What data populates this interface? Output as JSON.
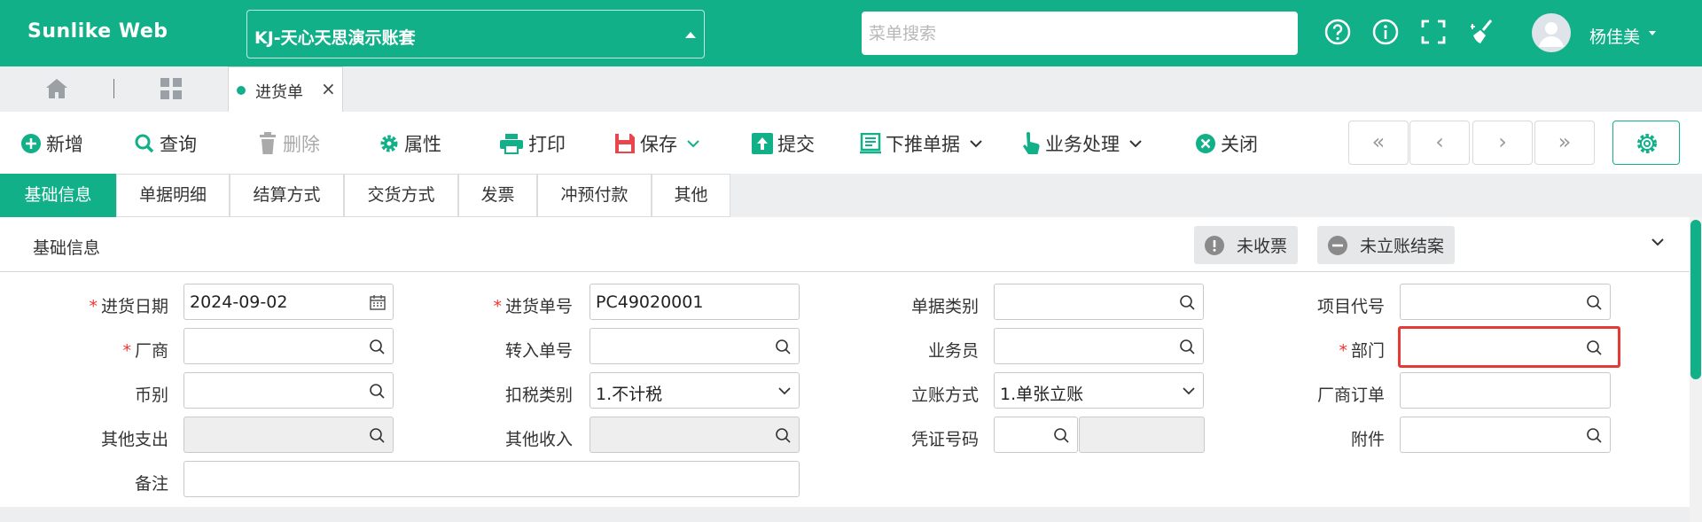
{
  "header": {
    "logo": "Sunlike Web",
    "account": "KJ-天心天思演示账套",
    "search_placeholder": "菜单搜索",
    "user": "杨佳美",
    "icons": [
      "help-icon",
      "info-icon",
      "fullscreen-icon",
      "clear-cache-icon"
    ]
  },
  "tabs": {
    "doc_tab": "进货单",
    "close": "×"
  },
  "toolbar": {
    "new": "新增",
    "query": "查询",
    "delete": "删除",
    "props": "属性",
    "print": "打印",
    "save": "保存",
    "submit": "提交",
    "push": "下推单据",
    "process": "业务处理",
    "close": "关闭",
    "nav": [
      "«",
      "‹",
      "›",
      "»"
    ]
  },
  "section_tabs": [
    "基础信息",
    "单据明细",
    "结算方式",
    "交货方式",
    "发票",
    "冲预付款",
    "其他"
  ],
  "section": {
    "title": "基础信息",
    "badge1": "未收票",
    "badge2": "未立账结案"
  },
  "form": {
    "date_label": "进货日期",
    "date_value": "2024-09-02",
    "no_label": "进货单号",
    "no_value": "PC49020001",
    "type_label": "单据类别",
    "project_label": "项目代号",
    "vendor_label": "厂商",
    "transfer_label": "转入单号",
    "salesman_label": "业务员",
    "dept_label": "部门",
    "currency_label": "币别",
    "tax_label": "扣税类别",
    "tax_value": "1.不计税",
    "account_label": "立账方式",
    "account_value": "1.单张立账",
    "vendor_order_label": "厂商订单",
    "other_exp_label": "其他支出",
    "other_inc_label": "其他收入",
    "voucher_label": "凭证号码",
    "attach_label": "附件",
    "remark_label": "备注",
    "required_mark": "*"
  },
  "colors": {
    "brand": "#12b089",
    "required": "#e33333",
    "focus_border": "#e53935"
  }
}
